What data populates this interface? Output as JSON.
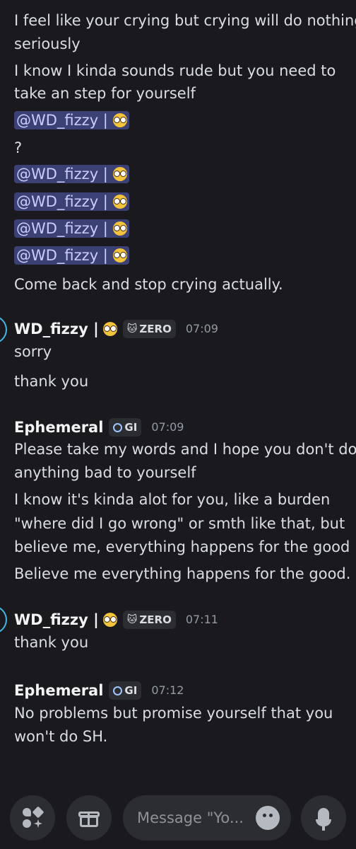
{
  "messages_top": {
    "line1": "I feel like your crying but crying will do nothing",
    "line2": "seriously",
    "line3": "I know I kinda sounds rude but you need to",
    "line4": "take an step for yourself",
    "mention": "@WD_fizzy |",
    "question": "?",
    "come_back": "Come back and stop crying actually."
  },
  "group1": {
    "username": "WD_fizzy |",
    "tag": "ZERO",
    "time": "07:09",
    "msg1": "sorry",
    "msg2": "thank you"
  },
  "group2": {
    "username": "Ephemeral",
    "tag": "GI",
    "time": "07:09",
    "line1": "Please take my words and I hope you don't do",
    "line2": "anything bad to yourself",
    "line3": "I know it's kinda alot for you, like a burden",
    "line4": "\"where did I go wrong\" or smth like that, but",
    "line5": "believe me, everything happens for the good",
    "line6": "Believe me everything happens for the good."
  },
  "group3": {
    "username": "WD_fizzy |",
    "tag": "ZERO",
    "time": "07:11",
    "msg1": "thank you"
  },
  "group4": {
    "username": "Ephemeral",
    "tag": "GI",
    "time": "07:12",
    "line1": "No problems but promise yourself that you",
    "line2": "won't do SH."
  },
  "composer": {
    "placeholder": "Message \"Yo..."
  },
  "colors": {
    "background": "#1a1a1e",
    "mention_bg": "#3c4175",
    "mention_text": "#c9cdfb",
    "avatar_ring": "#43b8e6"
  },
  "icons": {
    "apps": "apps-icon",
    "gift": "gift-icon",
    "emoji": "emoji-icon",
    "mic": "mic-icon"
  }
}
